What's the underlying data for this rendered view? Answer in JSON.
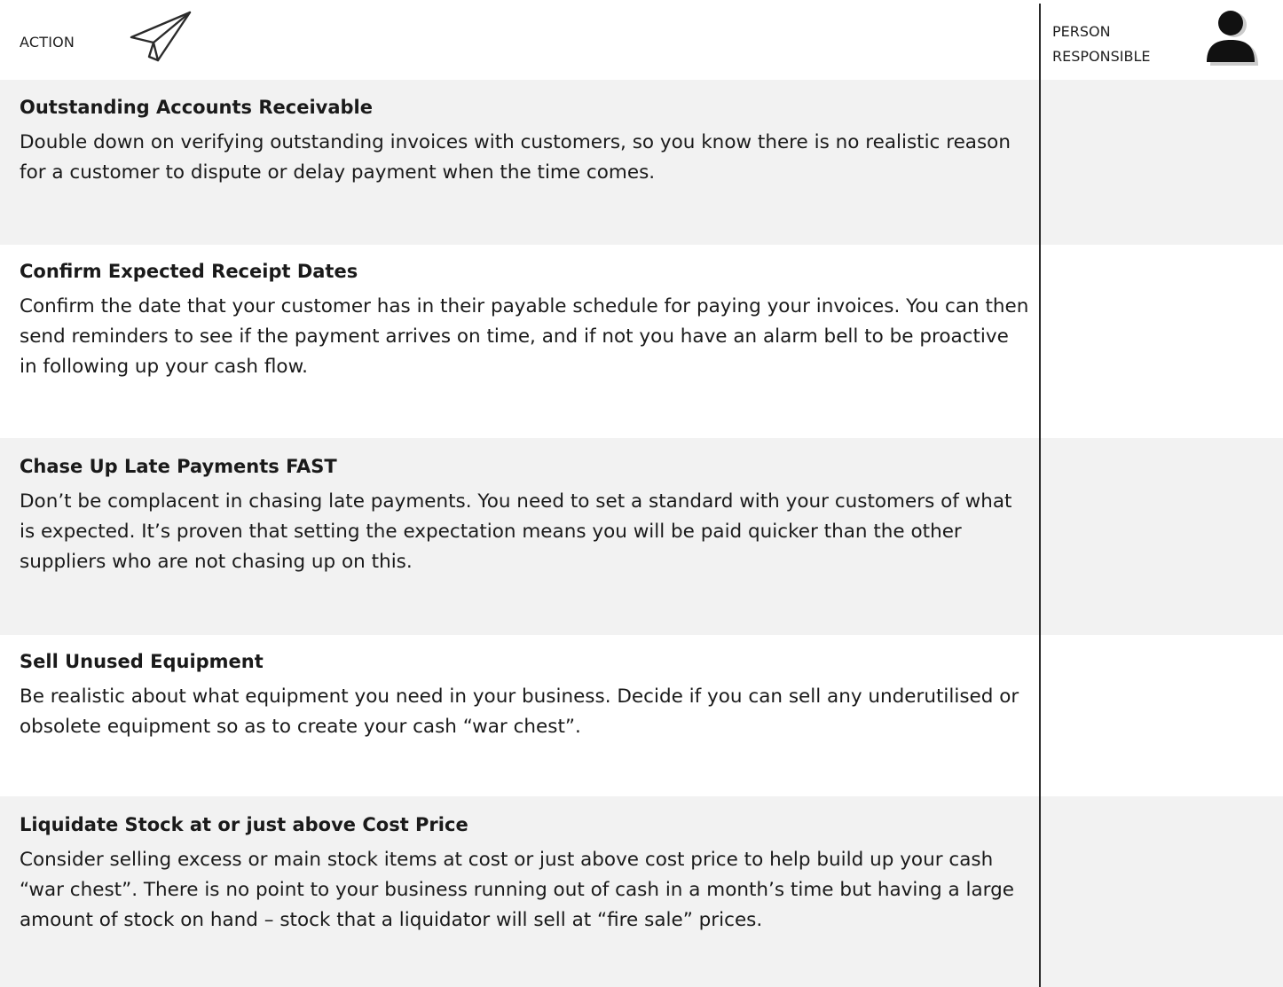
{
  "header": {
    "action_label": "ACTION",
    "person_label_line1": "PERSON",
    "person_label_line2": "RESPONSIBLE"
  },
  "icons": {
    "action": "paper-plane-icon",
    "person": "person-icon"
  },
  "colors": {
    "band": "#f2f2f2",
    "divider": "#2a2a2a"
  },
  "sections": [
    {
      "title": "Outstanding Accounts Receivable",
      "body": "Double down on verifying outstanding invoices with customers, so you know there is no realistic reason for a customer to dispute or delay payment when the time comes."
    },
    {
      "title": "Confirm Expected Receipt Dates",
      "body": "Confirm the date that your customer has in their payable schedule for paying your invoices. You can then send reminders to see if the payment arrives on time, and if not you have an alarm bell to be proactive in following up your cash flow."
    },
    {
      "title": "Chase Up Late Payments FAST",
      "body": "Don’t be complacent in chasing late payments. You need to set a standard with your customers of what is expected. It’s proven that setting the expectation means you will be paid quicker than the other suppliers who are not chasing up on this."
    },
    {
      "title": "Sell Unused Equipment",
      "body": "Be realistic about what equipment you need in your business. Decide if you can sell any underutilised or obsolete equipment so as to create your cash “war chest”."
    },
    {
      "title": "Liquidate Stock at or just above Cost Price",
      "body": "Consider selling excess or main stock items at cost or just above cost price to help build up your cash “war chest”. There is no point to your business running out of cash in a month’s time but having a large amount of stock on hand – stock that a liquidator will sell at “fire sale” prices."
    }
  ]
}
